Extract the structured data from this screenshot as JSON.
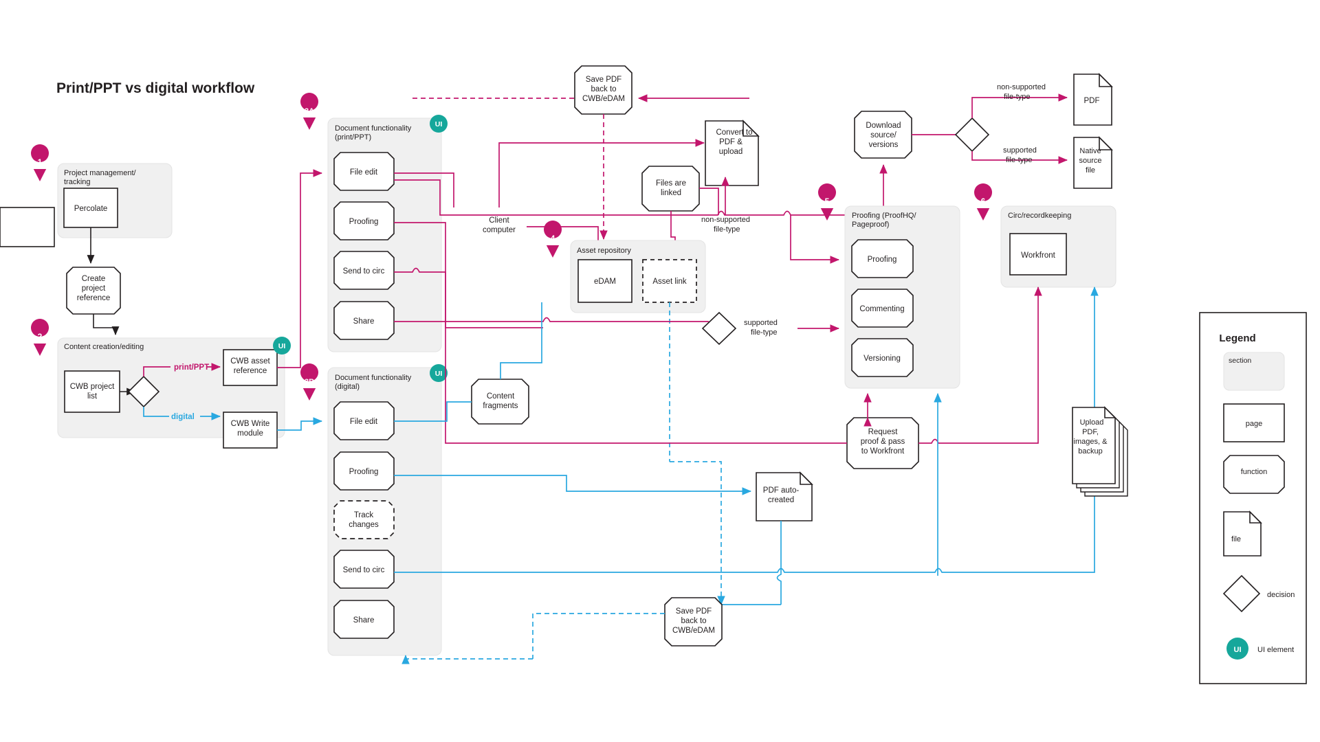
{
  "page": {
    "title": "Print/PPT vs digital workflow",
    "background": "#ffffff"
  },
  "colors": {
    "magenta": "#c2166c",
    "blue": "#29a8e0",
    "teal": "#16a79b",
    "section_fill": "#f0f0f0",
    "section_stroke": "#e3e3e3",
    "shape_stroke": "#231f20",
    "text": "#231f20"
  },
  "sections": [
    {
      "id": 1,
      "marker": "1",
      "title": "Project management/\ntracking",
      "title_lines": [
        "Project management/",
        "tracking"
      ],
      "ui_badge": false
    },
    {
      "id": 2,
      "marker": "2",
      "title": "Content creation/editing",
      "title_lines": [
        "Content creation/editing"
      ],
      "ui_badge": true
    },
    {
      "id": "3A",
      "marker": "3A",
      "title": "Document functionality (print/PPT)",
      "title_lines": [
        "Document functionality",
        "(print/PPT)"
      ],
      "ui_badge": true
    },
    {
      "id": "3B",
      "marker": "3B",
      "title": "Document functionality (digital)",
      "title_lines": [
        "Document functionality",
        "(digital)"
      ],
      "ui_badge": true
    },
    {
      "id": 4,
      "marker": "4",
      "title": "Asset repository",
      "title_lines": [
        "Asset repository"
      ],
      "ui_badge": false
    },
    {
      "id": 5,
      "marker": "5",
      "title": "Proofing (ProofHQ/Pageproof)",
      "title_lines": [
        "Proofing (ProofHQ/",
        "Pageproof)"
      ],
      "ui_badge": false
    },
    {
      "id": 6,
      "marker": "6",
      "title": "Circ/recordkeeping",
      "title_lines": [
        "Circ/recordkeeping"
      ],
      "ui_badge": false
    }
  ],
  "nodes": {
    "percolate": {
      "label": "Percolate",
      "lines": [
        "Percolate"
      ],
      "shape": "page"
    },
    "create_project": {
      "label": "Create project reference",
      "lines": [
        "Create",
        "project",
        "reference"
      ],
      "shape": "function"
    },
    "cwb_project_list": {
      "label": "CWB project list",
      "lines": [
        "CWB project",
        "list"
      ],
      "shape": "page"
    },
    "cwb_asset_ref": {
      "label": "CWB asset reference",
      "lines": [
        "CWB asset",
        "reference"
      ],
      "shape": "page"
    },
    "cwb_write": {
      "label": "CWB Write module",
      "lines": [
        "CWB Write",
        "module"
      ],
      "shape": "page"
    },
    "a_file_edit": {
      "label": "File edit",
      "lines": [
        "File edit"
      ],
      "shape": "function"
    },
    "a_proofing": {
      "label": "Proofing",
      "lines": [
        "Proofing"
      ],
      "shape": "function"
    },
    "a_send_to_circ": {
      "label": "Send to circ",
      "lines": [
        "Send to circ"
      ],
      "shape": "function"
    },
    "a_share": {
      "label": "Share",
      "lines": [
        "Share"
      ],
      "shape": "function"
    },
    "b_file_edit": {
      "label": "File edit",
      "lines": [
        "File edit"
      ],
      "shape": "function"
    },
    "b_proofing": {
      "label": "Proofing",
      "lines": [
        "Proofing"
      ],
      "shape": "function"
    },
    "b_track_changes": {
      "label": "Track changes",
      "lines": [
        "Track",
        "changes"
      ],
      "shape": "function-dashed"
    },
    "b_send_to_circ": {
      "label": "Send to circ",
      "lines": [
        "Send to circ"
      ],
      "shape": "function"
    },
    "b_share": {
      "label": "Share",
      "lines": [
        "Share"
      ],
      "shape": "function"
    },
    "client_computer": {
      "label": "Client computer",
      "lines": [
        "Client",
        "computer"
      ],
      "shape": "page"
    },
    "save_pdf_top": {
      "label": "Save PDF back to CWB/eDAM",
      "lines": [
        "Save PDF",
        "back to",
        "CWB/eDAM"
      ],
      "shape": "function"
    },
    "convert_to_pdf": {
      "label": "Convert to PDF & upload",
      "lines": [
        "Convert to",
        "PDF &",
        "upload"
      ],
      "shape": "file"
    },
    "files_are_linked": {
      "label": "Files are linked",
      "lines": [
        "Files are",
        "linked"
      ],
      "shape": "function"
    },
    "edam": {
      "label": "eDAM",
      "lines": [
        "eDAM"
      ],
      "shape": "page"
    },
    "asset_link": {
      "label": "Asset link",
      "lines": [
        "Asset link"
      ],
      "shape": "page-dashed"
    },
    "download_source": {
      "label": "Download source/versions",
      "lines": [
        "Download",
        "source/",
        "versions"
      ],
      "shape": "function"
    },
    "pdf_file": {
      "label": "PDF",
      "lines": [
        "PDF"
      ],
      "shape": "file"
    },
    "native_source": {
      "label": "Native source file",
      "lines": [
        "Native",
        "source",
        "file"
      ],
      "shape": "file"
    },
    "p_proofing": {
      "label": "Proofing",
      "lines": [
        "Proofing"
      ],
      "shape": "function"
    },
    "p_commenting": {
      "label": "Commenting",
      "lines": [
        "Commenting"
      ],
      "shape": "function"
    },
    "p_versioning": {
      "label": "Versioning",
      "lines": [
        "Versioning"
      ],
      "shape": "function"
    },
    "workfront": {
      "label": "Workfront",
      "lines": [
        "Workfront"
      ],
      "shape": "page"
    },
    "request_proof": {
      "label": "Request proof & pass to Workfront",
      "lines": [
        "Request",
        "proof & pass",
        "to Workfront"
      ],
      "shape": "function"
    },
    "content_fragments": {
      "label": "Content fragments",
      "lines": [
        "Content",
        "fragments"
      ],
      "shape": "function"
    },
    "pdf_auto_created": {
      "label": "PDF auto-created",
      "lines": [
        "PDF auto-",
        "created"
      ],
      "shape": "page"
    },
    "save_pdf_bottom": {
      "label": "Save PDF back to CWB/eDAM",
      "lines": [
        "Save PDF",
        "back to",
        "CWB/eDAM"
      ],
      "shape": "function"
    },
    "upload_stack": {
      "label": "Upload PDF, images, & backup",
      "lines": [
        "Upload",
        "PDF,",
        "images, &",
        "backup"
      ],
      "shape": "file-stack"
    }
  },
  "edge_labels": {
    "print_ppt": "print/PPT",
    "digital": "digital",
    "non_supported_mid": [
      "non-supported",
      "file-type"
    ],
    "supported_mid": [
      "supported",
      "file-type"
    ],
    "non_supported_right": [
      "non-supported",
      "file-type"
    ],
    "supported_right": [
      "supported",
      "file-type"
    ]
  },
  "ui_badge_label": "UI",
  "legend": {
    "title": "Legend",
    "items": [
      {
        "key": "section",
        "label": "section",
        "swatch": "section"
      },
      {
        "key": "page",
        "label": "page",
        "swatch": "page"
      },
      {
        "key": "function",
        "label": "function",
        "swatch": "function"
      },
      {
        "key": "file",
        "label": "file",
        "swatch": "file"
      },
      {
        "key": "decision",
        "label": "decision",
        "swatch": "decision"
      },
      {
        "key": "ui_element",
        "label": "UI element",
        "swatch": "ui"
      }
    ]
  }
}
